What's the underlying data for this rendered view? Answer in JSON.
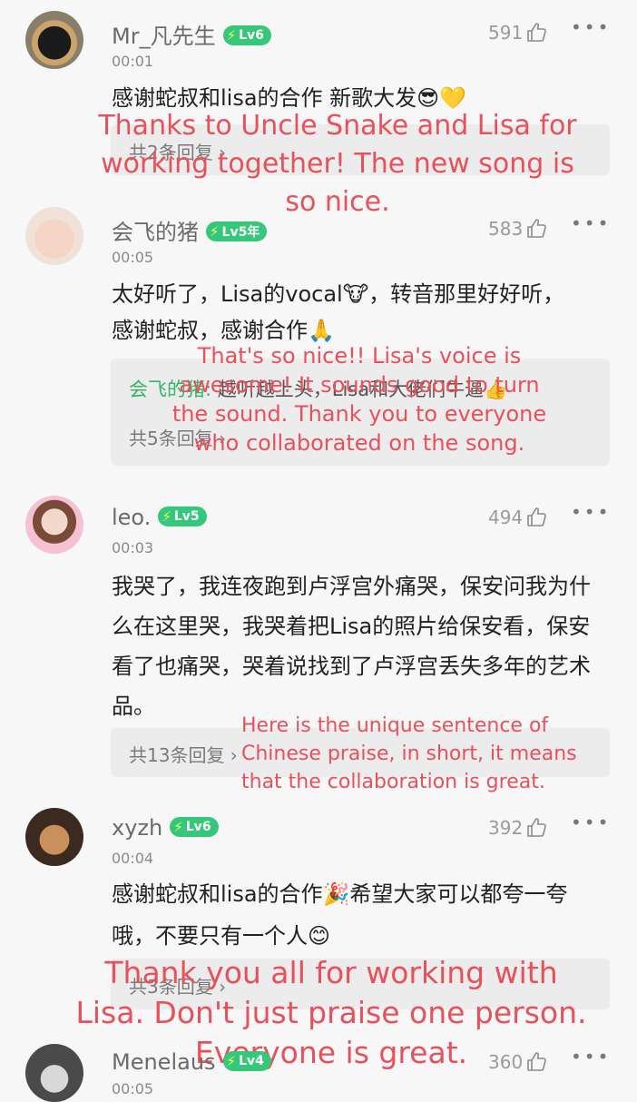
{
  "comments": [
    {
      "username": "Mr_凡先生",
      "level": "Lv6",
      "time": "00:01",
      "likes": "591",
      "text": "感谢蛇叔和lisa的合作 新歌大发😎💛",
      "reply_count": "共2条回复 ›",
      "overlay": "Thanks to Uncle Snake and Lisa for working together! The new song is so nice."
    },
    {
      "username": "会飞的猪",
      "level": "Lv5年",
      "time": "00:05",
      "likes": "583",
      "text": "太好听了，Lisa的vocal🐮，转音那里好好听，感谢蛇叔，感谢合作🙏",
      "reply_user": "会飞的猪:",
      "reply_text": "越听越上头，Lisa和大佬们牛逼👍",
      "reply_count": "共5条回复 ›",
      "overlay": "That's so nice!! Lisa's voice is awesome! It sounds good to turn the sound. Thank you to everyone who collaborated on the song."
    },
    {
      "username": "leo.",
      "level": "Lv5",
      "time": "00:03",
      "likes": "494",
      "text": "我哭了，我连夜跑到卢浮宫外痛哭，保安问我为什么在这里哭，我哭着把Lisa的照片给保安看，保安看了也痛哭，哭着说找到了卢浮宫丢失多年的艺术品。",
      "reply_count": "共13条回复 ›",
      "overlay": "Here is the unique sentence of Chinese praise, in short, it means that the collaboration is great."
    },
    {
      "username": "xyzh",
      "level": "Lv6",
      "time": "00:04",
      "likes": "392",
      "text": "感谢蛇叔和lisa的合作🎉希望大家可以都夸一夸哦，不要只有一个人😊",
      "reply_count": "共3条回复 ›",
      "overlay": "Thank you all for working with Lisa. Don't just praise one person. Everyone is great."
    },
    {
      "username": "Menelaus",
      "level": "Lv4",
      "time": "00:05",
      "likes": "360"
    }
  ],
  "icons": {
    "like": "thumbs-up-icon",
    "more": "more-dots-icon",
    "level": "lightning-icon"
  },
  "colors": {
    "accent": "#37c77b",
    "overlay_text": "#e8505b",
    "reply_user": "#33b56a"
  }
}
